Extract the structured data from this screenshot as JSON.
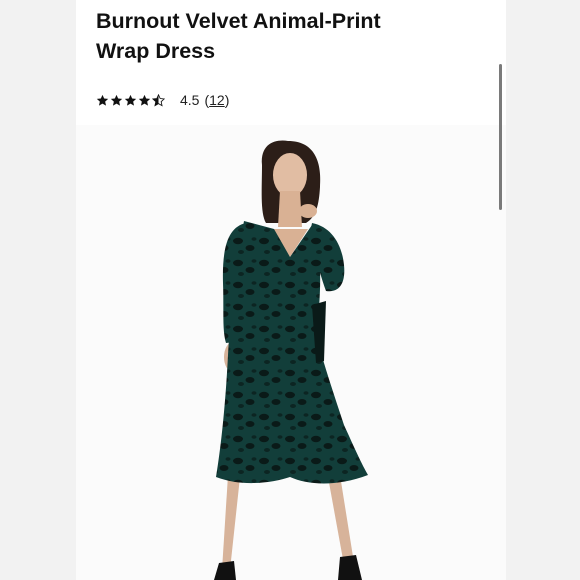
{
  "product": {
    "title_line1": "Burnout Velvet Animal-Print",
    "title_line2": "Wrap Dress",
    "rating": {
      "stars": 4.5,
      "max_stars": 5,
      "value_text": "4.5",
      "open_paren": "(",
      "count_text": "12",
      "close_paren": ")"
    }
  },
  "photo": {
    "subject": "model wearing dark teal burnout velvet wrap dress",
    "dress_color": "#123e3a",
    "background_color": "#fbfbfb"
  },
  "icons": {
    "star": "star-icon",
    "half_star": "half-star-icon"
  },
  "colors": {
    "text": "#111111",
    "page_bg": "#ffffff",
    "outer_bg": "#f2f2f2",
    "scrollbar": "#7a7a7a"
  }
}
